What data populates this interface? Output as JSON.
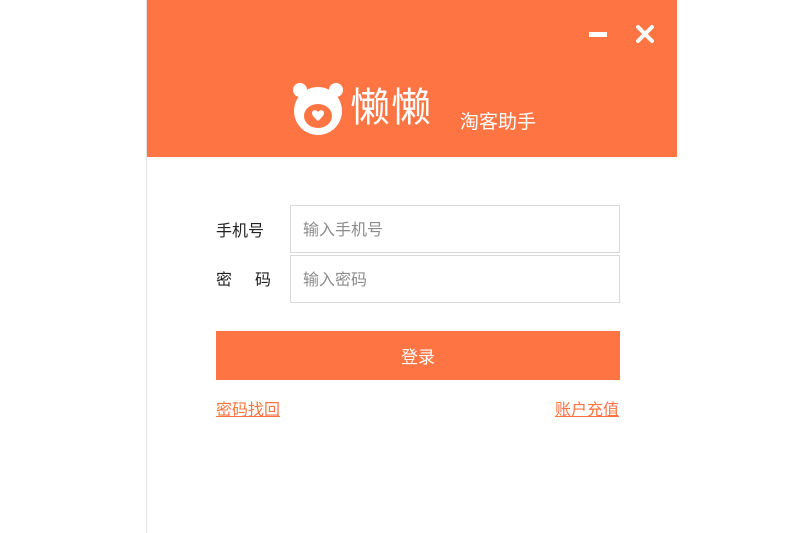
{
  "app": {
    "brand_name": "懒懒",
    "brand_subtitle": "淘客助手",
    "accent_color": "#ff7443",
    "logo_icon": "bear-face-icon"
  },
  "window_controls": {
    "minimize_icon": "minimize-icon",
    "close_icon": "close-icon"
  },
  "form": {
    "phone_label": "手机号",
    "phone_placeholder": "输入手机号",
    "phone_value": "",
    "password_label": "密码",
    "password_placeholder": "输入密码",
    "password_value": "",
    "login_label": "登录"
  },
  "links": {
    "forgot_password": "密码找回",
    "recharge": "账户充值"
  }
}
